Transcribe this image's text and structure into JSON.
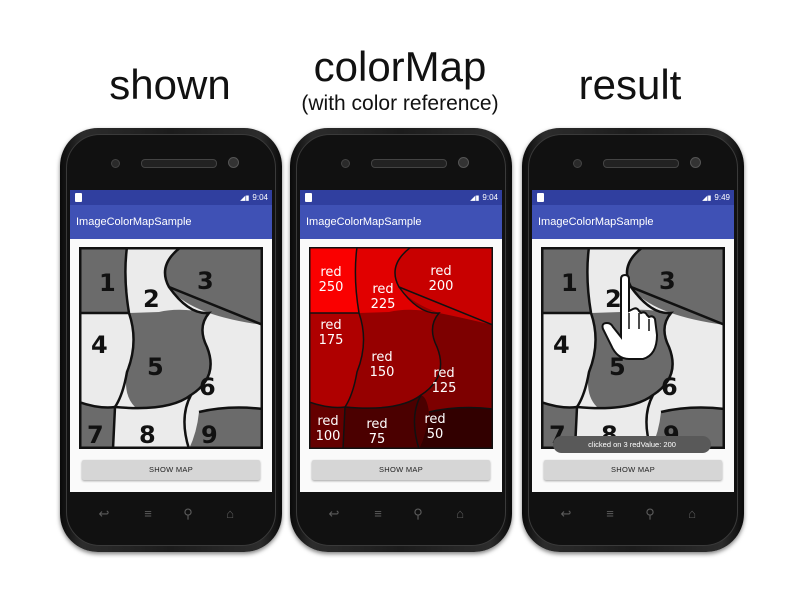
{
  "captions": {
    "shown": "shown",
    "colormap_title": "colorMap",
    "colormap_subtitle": "(with color reference)",
    "result": "result"
  },
  "app": {
    "title": "ImageColorMapSample",
    "button_label": "SHOW MAP"
  },
  "phones": [
    {
      "time": "9:04"
    },
    {
      "time": "9:04"
    },
    {
      "time": "9:49"
    }
  ],
  "regions": {
    "numbers": [
      "1",
      "2",
      "3",
      "4",
      "5",
      "6",
      "7",
      "8",
      "9"
    ],
    "colormap_labels": [
      {
        "word": "red",
        "value": "250"
      },
      {
        "word": "red",
        "value": "225"
      },
      {
        "word": "red",
        "value": "200"
      },
      {
        "word": "red",
        "value": "175"
      },
      {
        "word": "red",
        "value": "150"
      },
      {
        "word": "red",
        "value": "125"
      },
      {
        "word": "red",
        "value": "100"
      },
      {
        "word": "red",
        "value": "75"
      },
      {
        "word": "red",
        "value": "50"
      }
    ],
    "region_colors_shown": [
      "#6b6b6b",
      "#ebebeb",
      "#6b6b6b",
      "#ebebeb",
      "#6b6b6b",
      "#ebebeb",
      "#6b6b6b",
      "#ebebeb",
      "#6b6b6b"
    ],
    "region_colors_map": [
      "#fa0000",
      "#e10000",
      "#c80000",
      "#af0000",
      "#960000",
      "#7d0000",
      "#640000",
      "#4b0000",
      "#320000"
    ]
  },
  "toast": "clicked on 3 redValue: 200",
  "icons": {
    "nav_back": "back-icon",
    "nav_menu": "menu-icon",
    "nav_search": "search-icon",
    "nav_home": "home-icon",
    "cursor": "hand-pointer-icon"
  }
}
